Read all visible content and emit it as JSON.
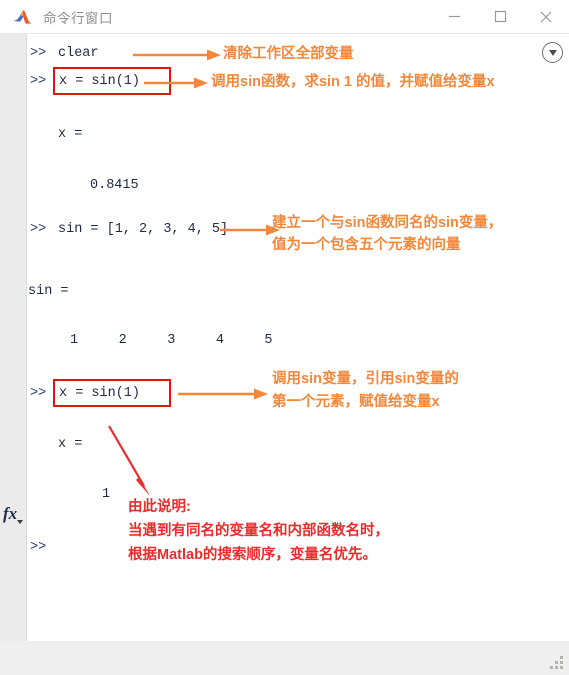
{
  "window": {
    "title": "命令行窗口",
    "logo_icon": "matlab-logo-icon",
    "controls": [
      {
        "name": "minimize-button",
        "icon": "minimize-icon",
        "label": "—"
      },
      {
        "name": "maximize-button",
        "icon": "maximize-icon",
        "label": "□"
      },
      {
        "name": "close-button",
        "icon": "close-icon",
        "label": "✕"
      }
    ]
  },
  "console": {
    "scroll_marker_icon": "chevron-down-circle-icon",
    "fx_icon": "fx-function-icon",
    "lines": [
      {
        "id": "l1",
        "prompt": ">>",
        "text": "clear"
      },
      {
        "id": "l2",
        "prompt": ">>",
        "text": "x = sin(1)",
        "boxed": true
      },
      {
        "id": "l3",
        "prompt": "",
        "text": "x ="
      },
      {
        "id": "l4",
        "prompt": "",
        "text": "0.8415"
      },
      {
        "id": "l5",
        "prompt": ">>",
        "text": "sin = [1, 2, 3, 4, 5]"
      },
      {
        "id": "l6",
        "prompt": "",
        "text": "sin ="
      },
      {
        "id": "l7",
        "prompt": "",
        "text": "1     2     3     4     5"
      },
      {
        "id": "l8",
        "prompt": ">>",
        "text": "x = sin(1)",
        "boxed": true
      },
      {
        "id": "l9",
        "prompt": "",
        "text": "x ="
      },
      {
        "id": "l10",
        "prompt": "",
        "text": "1"
      },
      {
        "id": "l11",
        "prompt": ">>",
        "text": ""
      }
    ]
  },
  "annotations": {
    "a1": "清除工作区全部变量",
    "a2": "调用sin函数，求sin 1 的值，并赋值给变量x",
    "a3_line1": "建立一个与sin函数同名的sin变量，",
    "a3_line2": "值为一个包含五个元素的向量",
    "a4_line1": "调用sin变量，引用sin变量的",
    "a4_line2": "第一个元素，赋值给变量x",
    "note_line1": "由此说明:",
    "note_line2": "当遇到有同名的变量名和内部函数名时，",
    "note_line3": "根据Matlab的搜索顺序，变量名优先。"
  },
  "colors": {
    "annotation_orange": "#f4873a",
    "annotation_red": "#ec2b2b",
    "highlight_box_red": "#e8120c",
    "console_text": "#1f2a44",
    "title_text": "#8f8f8f",
    "gutter": "#ebebeb",
    "window_chrome": "#efefef"
  }
}
